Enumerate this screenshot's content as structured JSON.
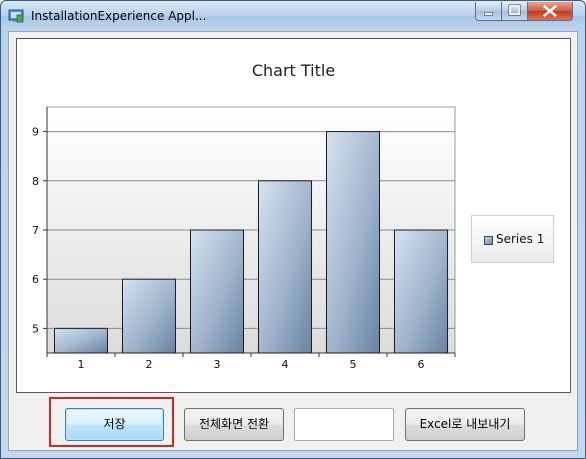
{
  "window": {
    "title": "InstallationExperience Appl..."
  },
  "chart_data": {
    "type": "bar",
    "title": "Chart Title",
    "categories": [
      "1",
      "2",
      "3",
      "4",
      "5",
      "6"
    ],
    "series": [
      {
        "name": "Series 1",
        "values": [
          5,
          6,
          7,
          8,
          9,
          7
        ]
      }
    ],
    "ylim": [
      4.5,
      9.5
    ],
    "yticks": [
      5,
      6,
      7,
      8,
      9
    ],
    "grid": true,
    "legend": "right"
  },
  "buttons": {
    "save": "저장",
    "fullscreen": "전체화면 전환",
    "excel": "Excel로 내보내기"
  },
  "input": {
    "value": ""
  }
}
